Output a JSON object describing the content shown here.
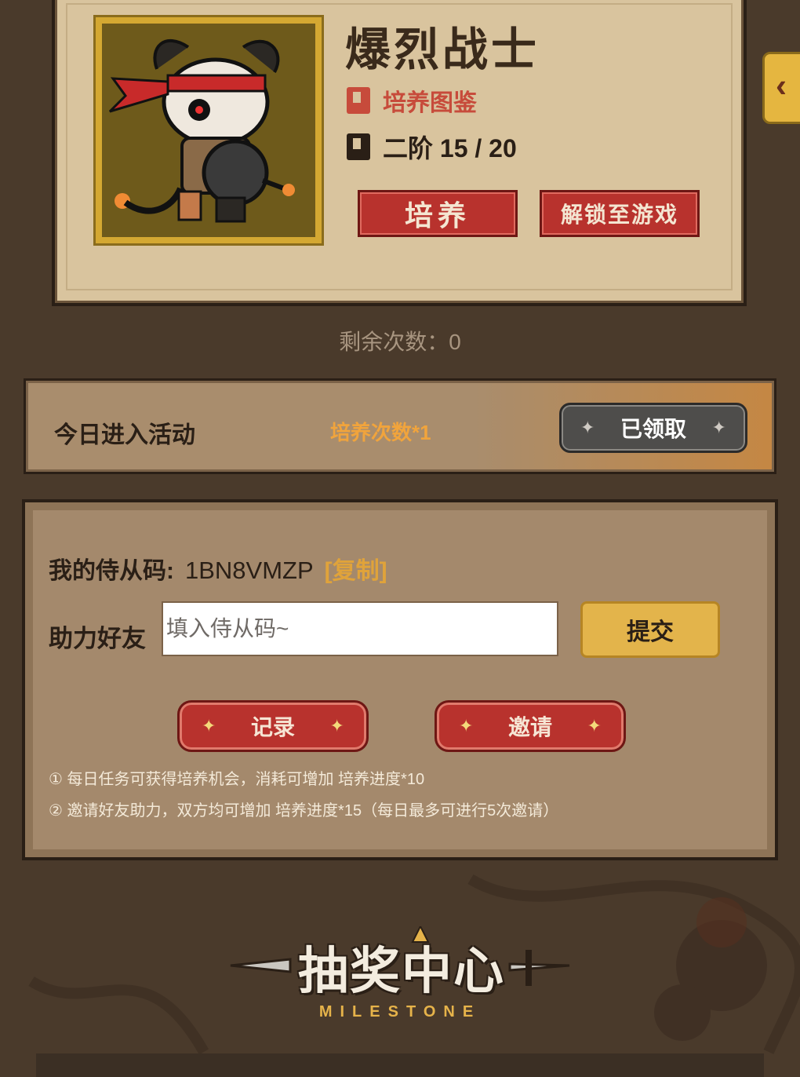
{
  "hero": {
    "title": "爆烈战士",
    "codex_label": "培养图鉴",
    "stage_label": "二阶 15 / 20",
    "cultivate_button": "培养",
    "unlock_button": "解锁至游戏",
    "side_tab_icon": "chevron-left-icon"
  },
  "remaining_text": "剩余次数：0",
  "activity": {
    "title": "今日进入活动",
    "reward": "培养次数*1",
    "claimed_button": "已领取"
  },
  "follower": {
    "code_label": "我的侍从码:",
    "code_value": "1BN8VMZP",
    "copy_link": "[复制]",
    "help_label": "助力好友",
    "input_placeholder": "填入侍从码~",
    "input_value": "",
    "submit_button": "提交",
    "record_button": "记录",
    "invite_button": "邀请",
    "note_1": "① 每日任务可获得培养机会，消耗可增加 培养进度*10",
    "note_2": "② 邀请好友助力，双方均可增加 培养进度*15（每日最多可进行5次邀请）"
  },
  "logo": {
    "title": "抽奖中心",
    "subtitle": "MILESTONE"
  },
  "colors": {
    "background": "#4a3a2b",
    "card": "#d9c49e",
    "red_button": "#b8322d",
    "gold": "#e3b44b",
    "reward_orange": "#f1a43c"
  }
}
